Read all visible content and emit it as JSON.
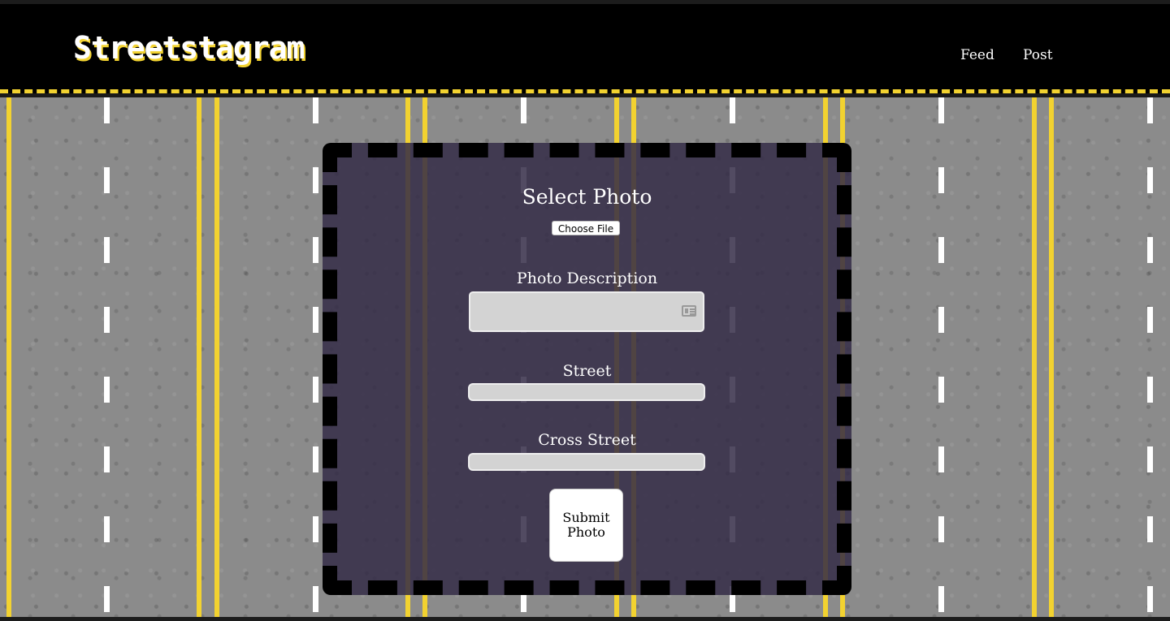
{
  "header": {
    "logo": "Streetstagram",
    "nav": [
      {
        "label": "Feed"
      },
      {
        "label": "Post"
      }
    ]
  },
  "form": {
    "title": "Select Photo",
    "choose_file_label": "Choose File",
    "description_label": "Photo Description",
    "description_value": "",
    "street_label": "Street",
    "street_value": "",
    "cross_street_label": "Cross Street",
    "cross_street_value": "",
    "submit_label": "Submit Photo"
  },
  "colors": {
    "header_bg": "#000000",
    "accent_yellow": "#f2d230",
    "card_bg": "#342c46",
    "input_bg": "#d3d3d3"
  }
}
